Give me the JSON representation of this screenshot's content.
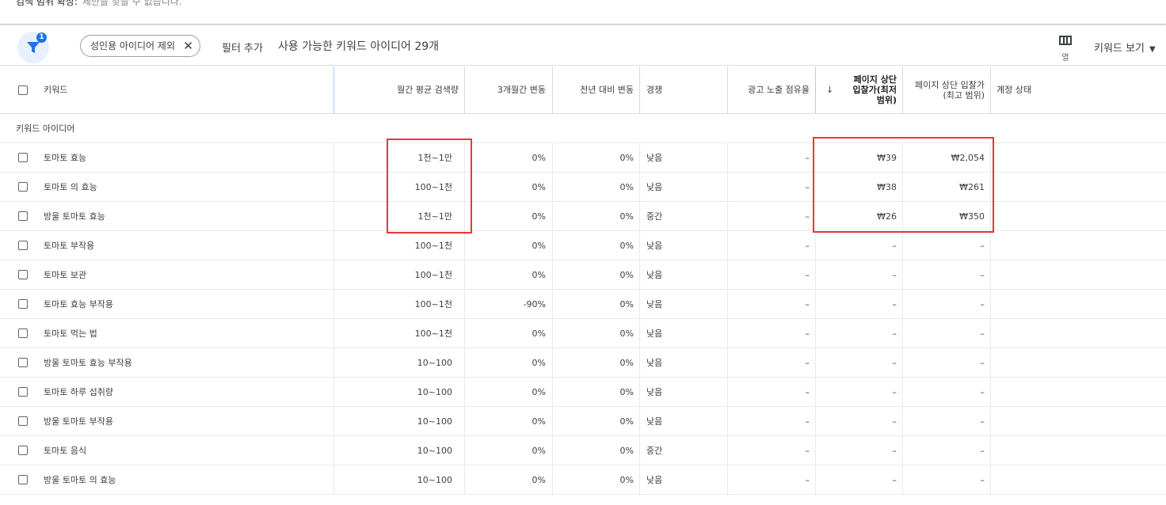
{
  "banner": {
    "label": "검색 범위 확장:",
    "value": "제안을 찾을 수 없습니다."
  },
  "toolbar": {
    "filter_badge": "1",
    "filter_icon": "filter-icon",
    "chip_label": "성인용 아이디어 제외",
    "chip_close": "✕",
    "add_filter": "필터 추가",
    "count_text": "사용 가능한 키워드 아이디어 29개",
    "columns_label": "열",
    "view_label": "키워드 보기"
  },
  "table": {
    "headers": {
      "keyword": "키워드",
      "monthly": "월간 평균 검색량",
      "three_month": "3개월간 변동",
      "yoy": "전년 대비 변동",
      "competition": "경쟁",
      "impression": "광고 노출 점유율",
      "sort_arrow": "↓",
      "bid_low_1": "페이지 상단",
      "bid_low_2": "입찰가(최저",
      "bid_low_3": "범위)",
      "bid_high_1": "페이지 상단 입찰가",
      "bid_high_2": "(최고 범위)",
      "status": "계정 상태"
    },
    "group_label": "키워드 아이디어",
    "rows": [
      {
        "keyword": "토마토 효능",
        "monthly": "1천~1만",
        "three": "0%",
        "yoy": "0%",
        "comp": "낮음",
        "imp": "–",
        "low": "₩39",
        "high": "₩2,054"
      },
      {
        "keyword": "토마토 의 효능",
        "monthly": "100~1천",
        "three": "0%",
        "yoy": "0%",
        "comp": "낮음",
        "imp": "–",
        "low": "₩38",
        "high": "₩261"
      },
      {
        "keyword": "방울 토마토 효능",
        "monthly": "1천~1만",
        "three": "0%",
        "yoy": "0%",
        "comp": "중간",
        "imp": "–",
        "low": "₩26",
        "high": "₩350"
      },
      {
        "keyword": "토마토 부작용",
        "monthly": "100~1천",
        "three": "0%",
        "yoy": "0%",
        "comp": "낮음",
        "imp": "–",
        "low": "–",
        "high": "–"
      },
      {
        "keyword": "토마토 보관",
        "monthly": "100~1천",
        "three": "0%",
        "yoy": "0%",
        "comp": "낮음",
        "imp": "–",
        "low": "–",
        "high": "–"
      },
      {
        "keyword": "토마토 효능 부작용",
        "monthly": "100~1천",
        "three": "-90%",
        "yoy": "0%",
        "comp": "낮음",
        "imp": "–",
        "low": "–",
        "high": "–"
      },
      {
        "keyword": "토마토 먹는 법",
        "monthly": "100~1천",
        "three": "0%",
        "yoy": "0%",
        "comp": "낮음",
        "imp": "–",
        "low": "–",
        "high": "–"
      },
      {
        "keyword": "방울 토마토 효능 부작용",
        "monthly": "10~100",
        "three": "0%",
        "yoy": "0%",
        "comp": "낮음",
        "imp": "–",
        "low": "–",
        "high": "–"
      },
      {
        "keyword": "토마토 하루 섭취량",
        "monthly": "10~100",
        "three": "0%",
        "yoy": "0%",
        "comp": "낮음",
        "imp": "–",
        "low": "–",
        "high": "–"
      },
      {
        "keyword": "방울 토마토 부작용",
        "monthly": "10~100",
        "three": "0%",
        "yoy": "0%",
        "comp": "낮음",
        "imp": "–",
        "low": "–",
        "high": "–"
      },
      {
        "keyword": "토마토 음식",
        "monthly": "10~100",
        "three": "0%",
        "yoy": "0%",
        "comp": "중간",
        "imp": "–",
        "low": "–",
        "high": "–"
      },
      {
        "keyword": "방울 토마토 의 효능",
        "monthly": "10~100",
        "three": "0%",
        "yoy": "0%",
        "comp": "낮음",
        "imp": "–",
        "low": "–",
        "high": "–"
      }
    ]
  },
  "colors": {
    "accent": "#1a73e8",
    "highlight": "#e53935"
  }
}
